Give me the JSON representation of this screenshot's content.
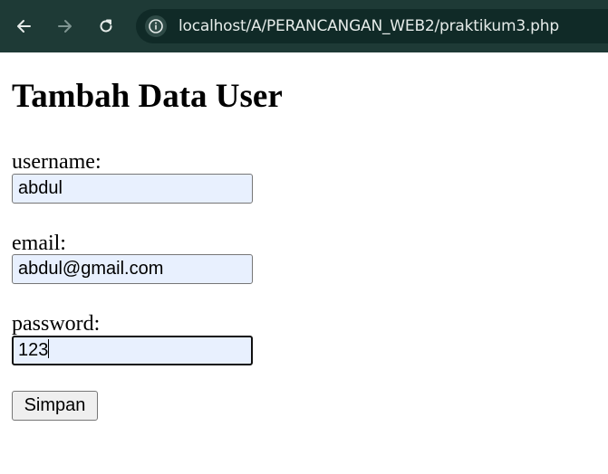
{
  "browser": {
    "url": "localhost/A/PERANCANGAN_WEB2/praktikum3.php",
    "icons": [
      "back-arrow-icon",
      "forward-arrow-icon",
      "reload-icon",
      "site-info-icon"
    ],
    "colors": {
      "toolbar": "#1e3a36",
      "url_box": "#102a27",
      "url_text": "#e6ecea"
    }
  },
  "page": {
    "title": "Tambah Data User",
    "form": {
      "username": {
        "label": "username:",
        "value": "abdul"
      },
      "email": {
        "label": "email:",
        "value": "abdul@gmail.com"
      },
      "password": {
        "label": "password:",
        "value": "123",
        "focused": true
      },
      "submit_label": "Simpan"
    },
    "colors": {
      "input_autofill_bg": "#e8f0fe",
      "button_bg": "#efefef"
    }
  }
}
